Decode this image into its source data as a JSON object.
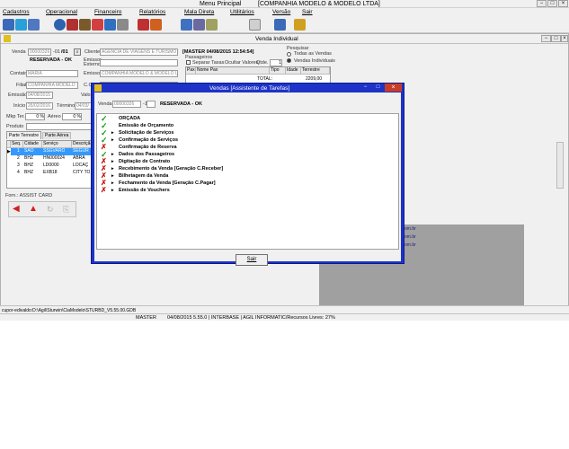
{
  "app": {
    "title": "Menu Principal",
    "company": "[COMPANHIA MODELO & MODELO LTDA]"
  },
  "menu": [
    {
      "label": "Cadastros"
    },
    {
      "label": "Operacional"
    },
    {
      "label": "Financeiro"
    },
    {
      "label": "Relatórios"
    },
    {
      "label": "Mala Direta"
    },
    {
      "label": "Utilitários"
    },
    {
      "label": "Versão"
    },
    {
      "label": "Sair"
    }
  ],
  "child": {
    "title": "Venda Individual",
    "venda_label": "Venda",
    "venda_num": "00000326",
    "venda_suffix": "-01",
    "venda_page": "/01",
    "status": "RESERVADA - OK",
    "cliente_label": "Cliente",
    "cliente_value": "AGENCIA DE VIAGENS E TURISMO",
    "emissor_externo_label": "Emissor Externo",
    "contato_label": "Contato",
    "contato_value": "MARIA",
    "emissor_label": "Emissor",
    "emissor_value": "COMPANHIA MODELO & MODELO LT",
    "filial_label": "Filial",
    "filial_value": "COMPANHIA MODELO",
    "cc_label": "C.C",
    "emissao_label": "Emissão",
    "emissao_value": "04/08/2015",
    "valor_label": "Valor",
    "inicio_label": "Início",
    "inicio_value": "26/02/2016",
    "termino_label": "Término",
    "termino_value": "04/03/",
    "markup_label": "Mkp Ter.",
    "markup_value": "0 %",
    "aereo_label": "Aéreo",
    "aereo_value": "0 %",
    "produto_label": "Produto",
    "master_line": "[MASTER 04/08/2015 12:54:54]",
    "passageiros_label": "Passageiros",
    "separar_taxas": "Separar Taxas",
    "ocultar_valores": "Ocultar Valores",
    "qtde_label": "Qtde.",
    "qtde_value": "1",
    "pesquisar_label": "Pesquisar",
    "todas_vendas": "Todas as Vendas",
    "vendas_individuais": "Vendas Individuais",
    "pax_headers": [
      "Pax",
      "Nome Pax",
      "Tipo",
      "Idade",
      "Terrestre"
    ],
    "total_label": "TOTAL:",
    "total_value": "2209,00",
    "tabs": [
      {
        "label": "Parte Terrestre"
      },
      {
        "label": "Parte Aérea"
      }
    ],
    "svc_headers": [
      "Seq.",
      "Cidade",
      "Serviço",
      "Descrição"
    ],
    "svc_rows": [
      {
        "seq": "1",
        "cidade": "SAO",
        "servico": "SSGVARO",
        "desc": "SEGUR"
      },
      {
        "seq": "2",
        "cidade": "BHZ",
        "servico": "HN000024",
        "desc": "ABRA"
      },
      {
        "seq": "3",
        "cidade": "BHZ",
        "servico": "LD0000",
        "desc": "LOCAÇ"
      },
      {
        "seq": "4",
        "cidade": "BHZ",
        "servico": "EXB18",
        "desc": "CITY TO"
      }
    ],
    "forn_label": "Forn.: ASSIST CARD"
  },
  "links": [
    "om.br",
    "om.br",
    "om.br"
  ],
  "status": {
    "path": "cupor-edivaldo:D:\\Agil\\Sturwin\\CiaModelo\\STURBD_V5.55.00.GDB",
    "user": "MASTER",
    "info": "04/08/2015 5.55.0 | INTERBASE | AGIL INFORMATIC/Recursos Livres: 27%"
  },
  "modal": {
    "title": "Vendas [Assistente de Tarefas]",
    "venda_label": "Venda",
    "venda_num": "00000326",
    "venda_suffix": "-1",
    "status": "RESERVADA - OK",
    "tasks": [
      {
        "label": "ORÇADA",
        "mark": "check",
        "arrow": false
      },
      {
        "label": "Emissão de Orçamento",
        "mark": "check",
        "arrow": false
      },
      {
        "label": "Solicitação de Serviços",
        "mark": "check",
        "arrow": true
      },
      {
        "label": "Confirmação de Serviços",
        "mark": "check",
        "arrow": true
      },
      {
        "label": "Confirmação de Reserva",
        "mark": "cross",
        "arrow": false
      },
      {
        "label": "Dados dos Passageiros",
        "mark": "check",
        "arrow": true
      },
      {
        "label": "Digitação de Contrato",
        "mark": "cross",
        "arrow": true
      },
      {
        "label": "Recebimento da Venda [Geração C.Receber]",
        "mark": "cross",
        "arrow": true
      },
      {
        "label": "Bilhetagem da Venda",
        "mark": "cross",
        "arrow": true
      },
      {
        "label": "Fechamento da Venda [Geração C.Pagar]",
        "mark": "cross",
        "arrow": true
      },
      {
        "label": "Emissão de Vouchers",
        "mark": "cross",
        "arrow": true
      }
    ],
    "sair_label": "Sair"
  },
  "colors": {
    "check": "#1a9a1a",
    "cross": "#c81414",
    "modal_border": "#1d33c7"
  }
}
